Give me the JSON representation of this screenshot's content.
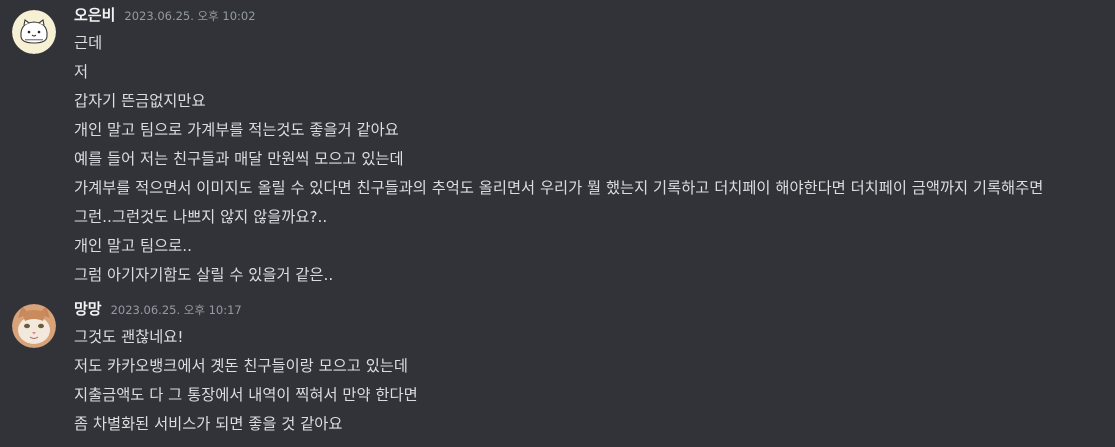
{
  "messages": [
    {
      "username": "오은비",
      "timestamp": "2023.06.25. 오후 10:02",
      "avatar_icon": "cartoon-face-avatar",
      "lines": [
        "근데",
        "저",
        "갑자기 뜬금없지만요",
        "개인 말고 팀으로 가계부를 적는것도 좋을거 같아요",
        "예를 들어 저는 친구들과 매달 만원씩 모으고 있는데",
        "가계부를 적으면서 이미지도 올릴 수 있다면 친구들과의 추억도 올리면서 우리가 뭘 했는지 기록하고 더치페이 해야한다면 더치페이 금액까지 기록해주면",
        "그런..그런것도 나쁘지 않지 않을까요?..",
        "개인 말고 팀으로..",
        "그럼 아기자기함도 살릴 수 있을거 같은.."
      ]
    },
    {
      "username": "망망",
      "timestamp": "2023.06.25. 오후 10:17",
      "avatar_icon": "cat-photo-avatar",
      "lines": [
        "그것도 괜찮네요!",
        "저도 카카오뱅크에서 곗돈 친구들이랑 모으고 있는데",
        "지출금액도 다 그 통장에서 내역이 찍혀서 만약 한다면",
        "좀 차별화된 서비스가 되면 좋을 것 같아요"
      ]
    }
  ]
}
